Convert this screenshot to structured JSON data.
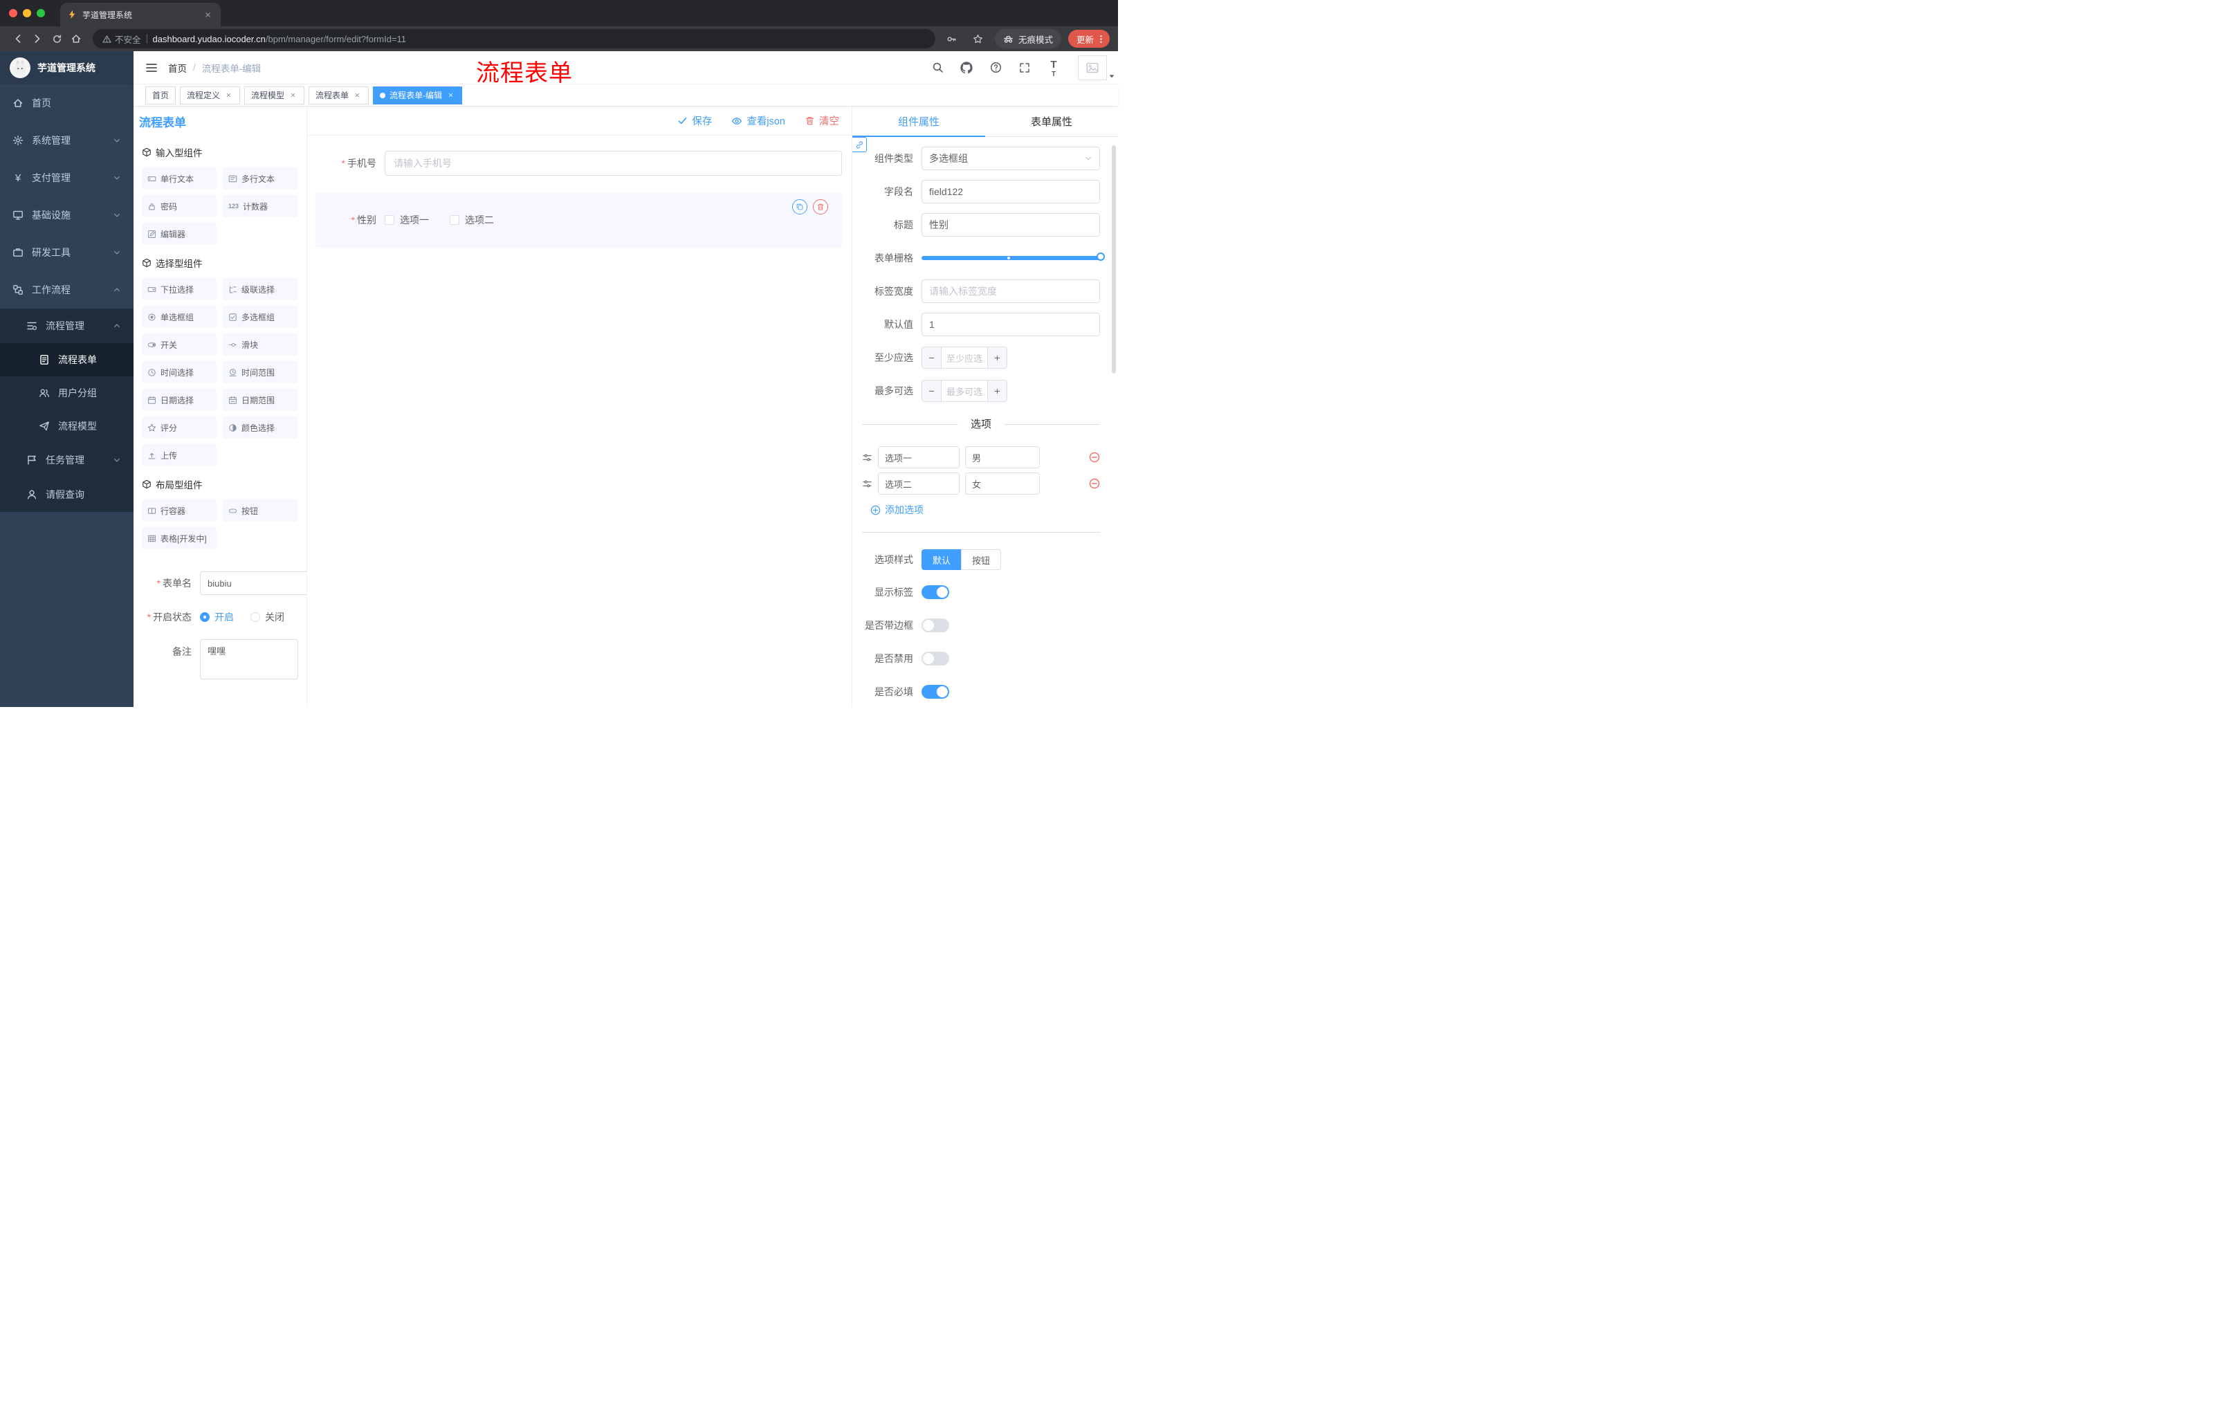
{
  "colors": {
    "primary": "#409EFF",
    "danger": "#F56C6C",
    "update_pill": "#E2574C",
    "sidebar_bg": "#304156"
  },
  "browser": {
    "tab_title": "芋道管理系统",
    "security_label": "不安全",
    "url_domain": "dashboard.yudao.iocoder.cn",
    "url_path": "/bpm/manager/form/edit?formId=11",
    "incognito_label": "无痕模式",
    "update_label": "更新"
  },
  "header": {
    "logo_title": "芋道管理系统",
    "breadcrumb_home": "首页",
    "breadcrumb_sep": "/",
    "breadcrumb_current": "流程表单-编辑",
    "overlay_title": "流程表单"
  },
  "tags": {
    "items": [
      {
        "label": "首页"
      },
      {
        "label": "流程定义"
      },
      {
        "label": "流程模型"
      },
      {
        "label": "流程表单"
      },
      {
        "label": "流程表单-编辑"
      }
    ]
  },
  "sidebar": {
    "home": "首页",
    "system": "系统管理",
    "payment": "支付管理",
    "infra": "基础设施",
    "devtools": "研发工具",
    "workflow": "工作流程",
    "process_mgmt": "流程管理",
    "process_form": "流程表单",
    "user_group": "用户分组",
    "process_model": "流程模型",
    "task_mgmt": "任务管理",
    "leave_query": "请假查询"
  },
  "designer": {
    "panel_title": "流程表单",
    "actions": {
      "save": "保存",
      "view_json": "查看json",
      "clear": "清空"
    },
    "palette": {
      "groups": [
        {
          "title": "输入型组件",
          "items": [
            "单行文本",
            "多行文本",
            "密码",
            "计数器",
            "编辑器"
          ]
        },
        {
          "title": "选择型组件",
          "items": [
            "下拉选择",
            "级联选择",
            "单选框组",
            "多选框组",
            "开关",
            "滑块",
            "时间选择",
            "时间范围",
            "日期选择",
            "日期范围",
            "评分",
            "颜色选择",
            "上传"
          ]
        },
        {
          "title": "布局型组件",
          "items": [
            "行容器",
            "按钮",
            "表格[开发中]"
          ]
        }
      ],
      "counter_icon_text": "123"
    },
    "form_meta": {
      "name_label": "表单名",
      "name_value": "biubiu",
      "status_label": "开启状态",
      "status_on": "开启",
      "status_off": "关闭",
      "remark_label": "备注",
      "remark_value": "嘿嘿"
    },
    "canvas": {
      "phone_label": "手机号",
      "phone_placeholder": "请输入手机号"
    },
    "props": {
      "tab_component": "组件属性",
      "tab_form": "表单属性",
      "component_type_label": "组件类型",
      "component_type_value": "多选框组",
      "field_name_label": "字段名",
      "field_name_value": "field122",
      "title_label": "标题",
      "title_value": "性别",
      "grid_label": "表单栅格",
      "label_width_label": "标签宽度",
      "label_width_placeholder": "请输入标签宽度",
      "default_label": "默认值",
      "default_value": "1",
      "min_label": "至少应选",
      "min_placeholder": "至少应选",
      "max_label": "最多可选",
      "max_placeholder": "最多可选",
      "options_title": "选项",
      "options": [
        {
          "label": "选项一",
          "value": "男"
        },
        {
          "label": "选项二",
          "value": "女"
        }
      ],
      "add_option": "添加选项",
      "option_style_label": "选项样式",
      "style_default": "默认",
      "style_button": "按钮",
      "switch_show_label": "显示标签",
      "switch_border": "是否带边框",
      "switch_disabled": "是否禁用",
      "switch_required": "是否必填"
    }
  }
}
